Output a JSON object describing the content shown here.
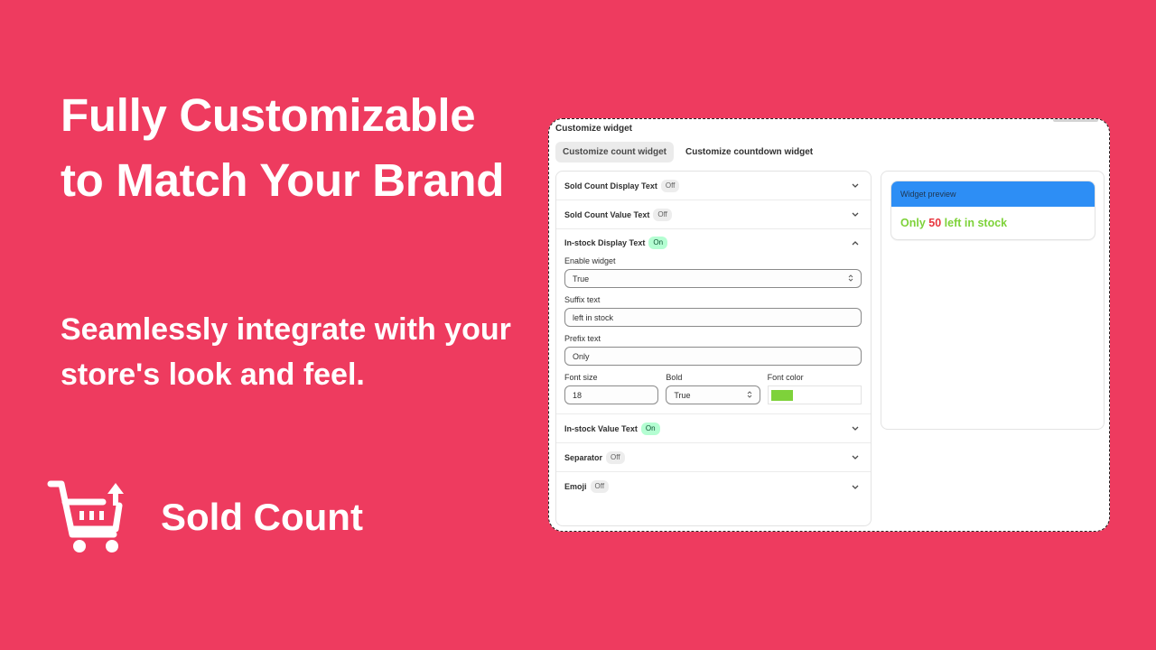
{
  "hero": {
    "title": "Fully Customizable to Match Your Brand",
    "subtitle": "Seamlessly integrate with your store's look and feel."
  },
  "brand": {
    "name": "Sold Count",
    "icon": "cart-upload-icon"
  },
  "colors": {
    "background": "#EE3B5F",
    "preview_header": "#2d8ef5",
    "preview_text": "#7ed23a",
    "preview_value": "#e8363f",
    "badge_on_bg": "#b4fed2",
    "badge_off_bg": "#ededed"
  },
  "window": {
    "title": "Customize widget",
    "tabs": [
      {
        "label": "Customize count widget",
        "active": true
      },
      {
        "label": "Customize countdown widget",
        "active": false
      }
    ]
  },
  "settings": {
    "sections": [
      {
        "label": "Sold Count Display Text",
        "status": "Off"
      },
      {
        "label": "Sold Count Value Text",
        "status": "Off"
      },
      {
        "label": "In-stock Display Text",
        "status": "On"
      },
      {
        "label": "In-stock Value Text",
        "status": "On"
      },
      {
        "label": "Separator",
        "status": "Off"
      },
      {
        "label": "Emoji",
        "status": "Off"
      }
    ],
    "instock_display": {
      "enable_label": "Enable widget",
      "enable_value": "True",
      "suffix_label": "Suffix text",
      "suffix_value": "left in stock",
      "prefix_label": "Prefix text",
      "prefix_value": "Only",
      "font_size_label": "Font size",
      "font_size_value": "18",
      "bold_label": "Bold",
      "bold_value": "True",
      "font_color_label": "Font color",
      "font_color_value": "#7ed23a"
    }
  },
  "preview": {
    "header": "Widget preview",
    "prefix": "Only",
    "value": "50",
    "suffix": "left in stock"
  }
}
